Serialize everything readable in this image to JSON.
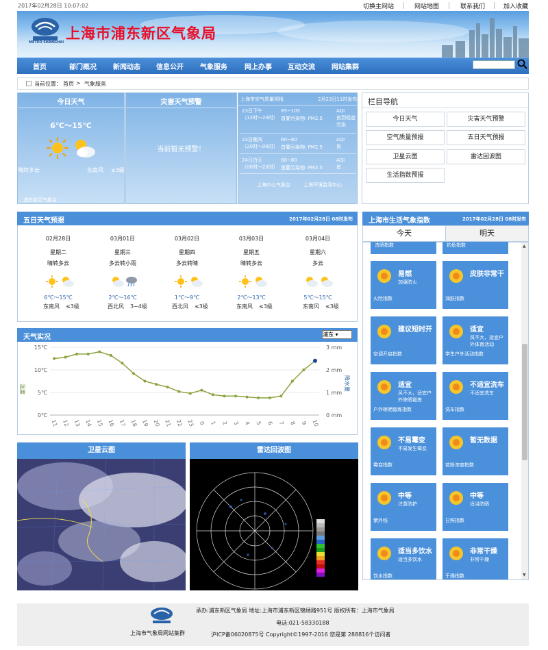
{
  "topbar": {
    "datetime": "2017年02月28日  10:07:02",
    "links": [
      "切换主网站",
      "网站地图",
      "联系我们",
      "加入收藏"
    ]
  },
  "banner": {
    "title": "上海市浦东新区气象局",
    "logo_text": "METEO SHANGHAI"
  },
  "nav": {
    "items": [
      "首页",
      "部门概况",
      "新闻动态",
      "信息公开",
      "气象服务",
      "网上办事",
      "互动交流",
      "网站集群"
    ],
    "search_placeholder": ""
  },
  "breadcrumb": {
    "label": "当前位置：",
    "home": "首页",
    "arrow": ">",
    "current": "气象服务"
  },
  "today": {
    "title": "今日天气",
    "temp": "6℃～15℃",
    "desc": "晴转多云",
    "wind_dir": "东南风",
    "wind_level": "≤3级",
    "source": "浦东新区气象台"
  },
  "warning": {
    "title": "灾害天气预警",
    "text": "当前暂无预警！"
  },
  "aqi": {
    "title": "上海市空气质量预报",
    "date": "2月23日11时发布",
    "rows": [
      {
        "period": "23日下午",
        "range": "（12时～20时）",
        "value": "85~105",
        "pollutant": "首要污染物: PM2.5",
        "aqi_label": "AQI",
        "level": "良到轻度污染"
      },
      {
        "period": "23日晚间",
        "range": "（20时～06时）",
        "value": "60~80",
        "pollutant": "首要污染物: PM2.5",
        "aqi_label": "AQI",
        "level": "良"
      },
      {
        "period": "24日白天",
        "range": "（06时～20时）",
        "value": "60~80",
        "pollutant": "首要污染物: PM2.5",
        "aqi_label": "AQI",
        "level": "良"
      }
    ],
    "link1": "上海中心气象台",
    "link2": "上海环境监测中心"
  },
  "colnav": {
    "title": "栏目导航",
    "items": [
      "今日天气",
      "灾害天气预警",
      "空气质量预报",
      "五日天气预报",
      "卫星云图",
      "雷达回波图",
      "生活指数预报"
    ]
  },
  "five": {
    "title": "五日天气预报",
    "date": "2017年02月28日 08时发布",
    "days": [
      {
        "date": "02月28日",
        "week": "星期二",
        "desc": "晴转多云",
        "temp": "6℃～15℃",
        "dir": "东南风",
        "lvl": "≤3级"
      },
      {
        "date": "03月01日",
        "week": "星期三",
        "desc": "多云转小雨",
        "temp": "2℃～16℃",
        "dir": "西北风",
        "lvl": "3~4级"
      },
      {
        "date": "03月02日",
        "week": "星期四",
        "desc": "多云转晴",
        "temp": "1℃～9℃",
        "dir": "西北风",
        "lvl": "≤3级"
      },
      {
        "date": "03月03日",
        "week": "星期五",
        "desc": "晴转多云",
        "temp": "2℃～13℃",
        "dir": "东南风",
        "lvl": "≤3级"
      },
      {
        "date": "03月04日",
        "week": "星期六",
        "desc": "多云",
        "temp": "5℃～15℃",
        "dir": "东南风",
        "lvl": "≤3级"
      }
    ]
  },
  "live": {
    "title": "天气实况",
    "city": "浦东 ▾"
  },
  "chart_data": {
    "type": "line",
    "x": [
      "11",
      "12",
      "13",
      "14",
      "15",
      "16",
      "17",
      "18",
      "19",
      "20",
      "21",
      "22",
      "23",
      "0",
      "1",
      "2",
      "3",
      "4",
      "5",
      "6",
      "7",
      "8",
      "9",
      "10"
    ],
    "values": [
      12.5,
      12.8,
      13.5,
      13.5,
      14,
      13.2,
      11.5,
      9.2,
      7.5,
      6.8,
      6.2,
      5.2,
      4.8,
      5.5,
      4.5,
      4.2,
      4.2,
      4.0,
      3.8,
      3.8,
      4.2,
      7.5,
      10,
      12
    ],
    "yleft_ticks": [
      "15℃",
      "10℃",
      "5℃",
      "0℃"
    ],
    "yright_ticks": [
      "3 mm",
      "2 mm",
      "1 mm",
      "0 mm"
    ],
    "ylabel": "温度",
    "y2label": "降水量",
    "ylim": [
      0,
      15
    ],
    "grid": true
  },
  "satellite": {
    "title": "卫星云图"
  },
  "radar": {
    "title": "雷达回波图"
  },
  "life": {
    "title": "上海市生活气象指数",
    "date": "2017年02月28日 08时发布",
    "tabs": [
      "今天",
      "明天"
    ],
    "top_cut": [
      "洗晒指数",
      "钓鱼指数"
    ],
    "cards": [
      {
        "icon": "fire-icon",
        "title": "易燃",
        "sub": "加强防火",
        "bottom": "火险指数"
      },
      {
        "icon": "hands-icon",
        "title": "皮肤非常干",
        "sub": "",
        "bottom": "润肤指数"
      },
      {
        "icon": "snowflake-icon",
        "title": "建议短时开",
        "sub": "",
        "bottom": "空调开启指数"
      },
      {
        "icon": "runner-icon",
        "title": "适宜",
        "sub": "风不大，适宜户外体育活动",
        "bottom": "学生户外活动指数"
      },
      {
        "icon": "tent-icon",
        "title": "适宜",
        "sub": "风不大，适宜户外晾晒锻炼",
        "bottom": "户外晾晒锻炼指数"
      },
      {
        "icon": "car-icon",
        "title": "不适宜洗车",
        "sub": "不适宜洗车",
        "bottom": "洗车指数"
      },
      {
        "icon": "mold-icon",
        "title": "不易霉变",
        "sub": "不易发生霉变",
        "bottom": "霉变指数"
      },
      {
        "icon": "flower-icon",
        "title": "暂无数据",
        "sub": "",
        "bottom": "花粉浓度指数"
      },
      {
        "icon": "uv-icon",
        "title": "中等",
        "sub": "注意防护",
        "bottom": "紫外线"
      },
      {
        "icon": "sun-icon",
        "title": "中等",
        "sub": "适当防晒",
        "bottom": "日照指数"
      },
      {
        "icon": "water-drop-icon",
        "title": "适当多饮水",
        "sub": "适当多饮水",
        "bottom": "饮水指数"
      },
      {
        "icon": "hands-dry-icon",
        "title": "非常干燥",
        "sub": "非常干燥",
        "bottom": "干燥指数"
      }
    ]
  },
  "footer": {
    "line1": "承办:浦东新区气象局 地址:上海市浦东新区锦绣路951号 版权所有：上海市气象局",
    "line2": "电话:021-58330188",
    "line3": "沪ICP备06020875号 Copyright©1997-2016  您是第 288816个访问者",
    "logo_label": "上海市气象局网站集群"
  }
}
